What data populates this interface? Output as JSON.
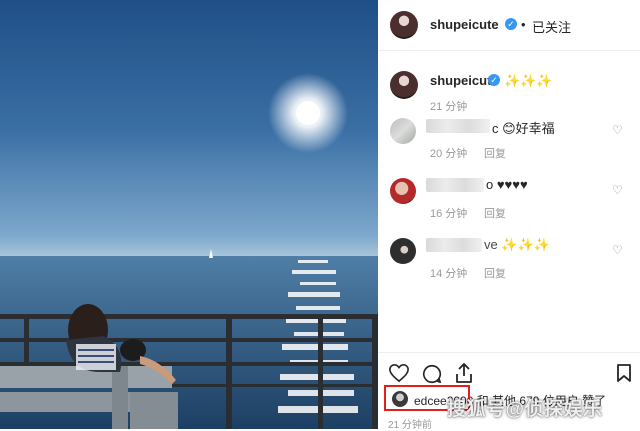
{
  "post": {
    "author": "shupeicute",
    "follow_status": "已关注",
    "dot": "•"
  },
  "caption": {
    "author": "shupeicute",
    "text": "✨✨✨",
    "time": "21 分钟"
  },
  "comments": [
    {
      "text_visible": "c 😊好幸福",
      "time": "20 分钟",
      "reply": "回复"
    },
    {
      "text_visible": "o ♥♥♥♥",
      "time": "16 分钟",
      "reply": "回复"
    },
    {
      "text_visible": "ve ✨✨✨",
      "time": "14 分钟",
      "reply": "回复"
    }
  ],
  "likes": {
    "text": "edcee2000 和 其他 679 位用户 赞了"
  },
  "timestamp": "21 分钟前",
  "watermark": "搜狐号@侦探娱乐",
  "colors": {
    "verified": "#3897f0",
    "highlight": "#e0201b",
    "meta": "#999999"
  }
}
